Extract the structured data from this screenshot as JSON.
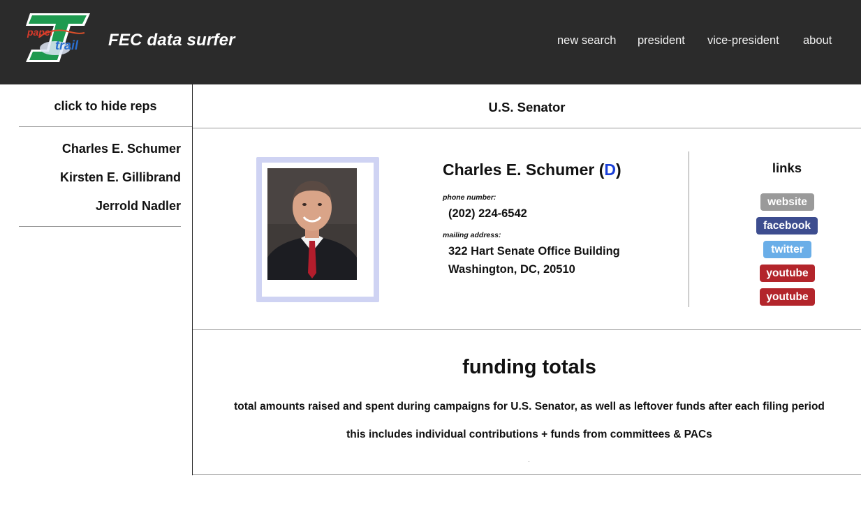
{
  "header": {
    "logo_text_top": "paper",
    "logo_text_bottom": "trail",
    "brand": "FEC data surfer",
    "nav": [
      "new search",
      "president",
      "vice-president",
      "about"
    ]
  },
  "sidebar": {
    "toggle": "click to hide reps",
    "reps": [
      "Charles E. Schumer",
      "Kirsten E. Gillibrand",
      "Jerrold Nadler"
    ]
  },
  "office": "U.S. Senator",
  "rep": {
    "name": "Charles E. Schumer",
    "party_open": " (",
    "party": "D",
    "party_close": ")",
    "phone_label": "phone number:",
    "phone": "(202) 224-6542",
    "address_label": "mailing address:",
    "address_line1": "322 Hart Senate Office Building",
    "address_line2": "Washington, DC, 20510",
    "party_color": "#1a3fd8"
  },
  "links": {
    "title": "links",
    "buttons": [
      {
        "label": "website",
        "color": "#9a9a9a"
      },
      {
        "label": "facebook",
        "color": "#3d4d8f"
      },
      {
        "label": "twitter",
        "color": "#6aaee8"
      },
      {
        "label": "youtube",
        "color": "#b3252b"
      },
      {
        "label": "youtube",
        "color": "#b3252b"
      }
    ]
  },
  "funding": {
    "title": "funding totals",
    "desc1": "total amounts raised and spent during campaigns for U.S. Senator, as well as leftover funds after each filing period",
    "desc2": "this includes individual contributions + funds from committees & PACs"
  }
}
